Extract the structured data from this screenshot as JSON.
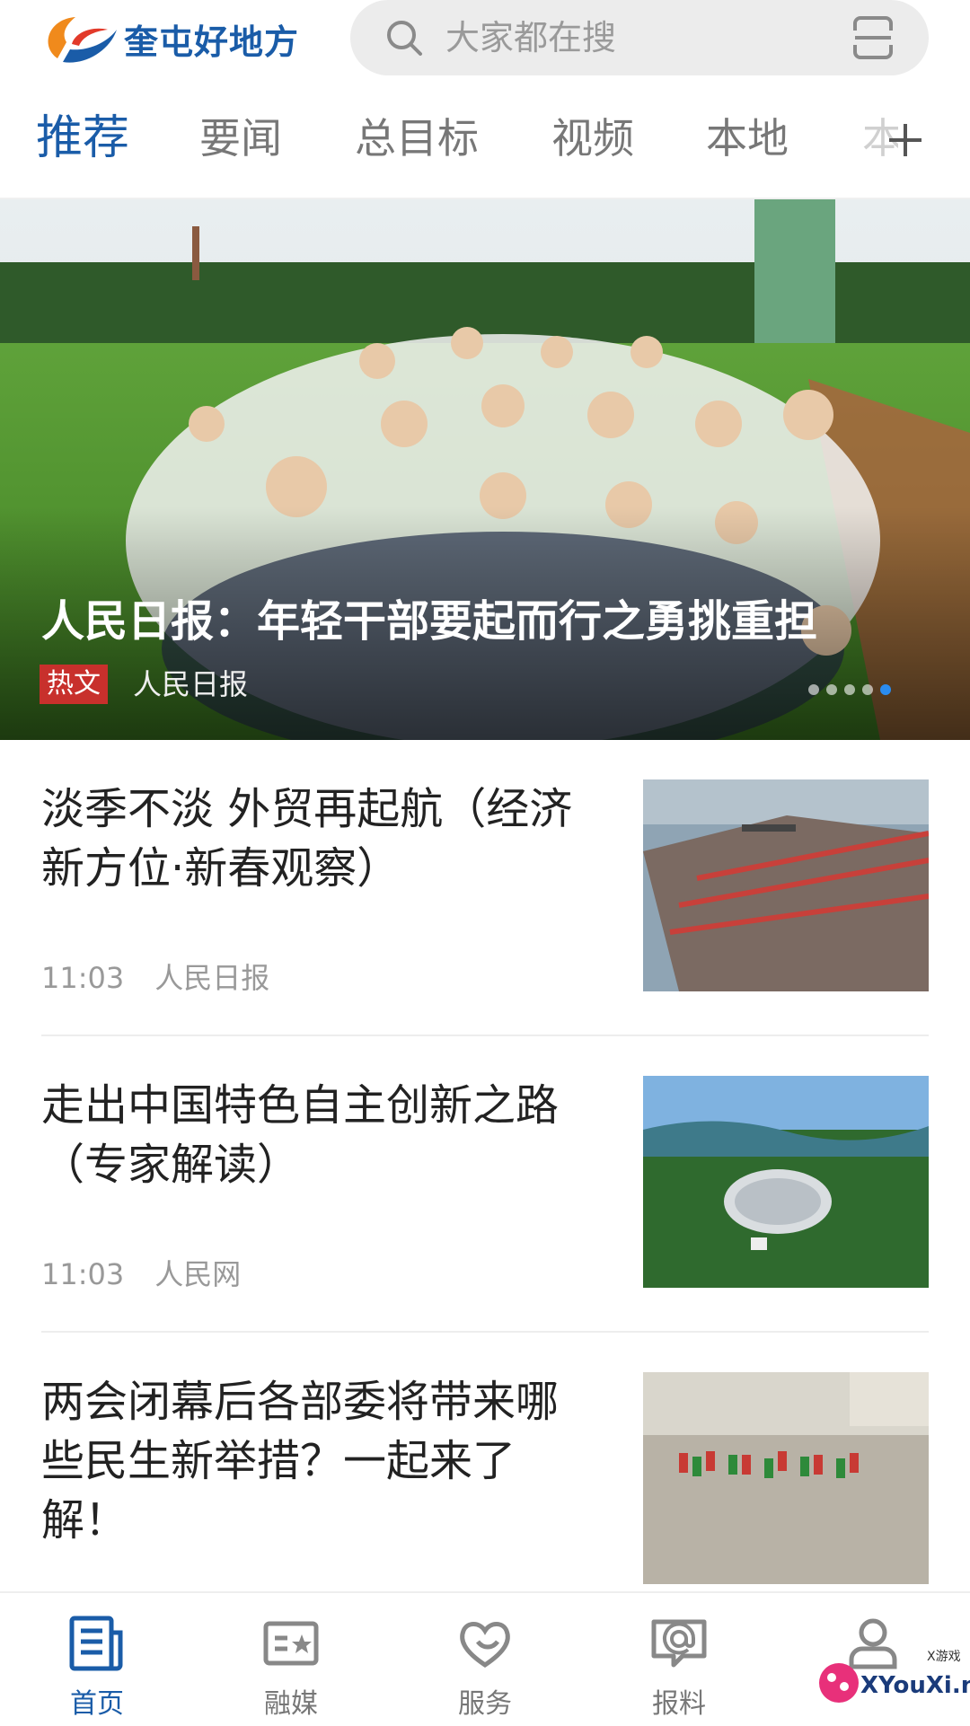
{
  "header": {
    "logo_text": "奎屯好地方",
    "search_placeholder": "大家都在搜"
  },
  "tabs": [
    {
      "label": "推荐",
      "active": true
    },
    {
      "label": "要闻",
      "active": false
    },
    {
      "label": "总目标",
      "active": false
    },
    {
      "label": "视频",
      "active": false
    },
    {
      "label": "本地",
      "active": false
    },
    {
      "label": "本",
      "active": false
    }
  ],
  "hero": {
    "title": "人民日报：年轻干部要起而行之勇挑重担",
    "badge": "热文",
    "source": "人民日报",
    "slide_count": 5,
    "active_slide": 5
  },
  "news": [
    {
      "title": "淡季不淡 外贸再起航（经济新方位·新春观察）",
      "time": "11:03",
      "source": "人民日报",
      "thumb": "port-containers"
    },
    {
      "title": "走出中国特色自主创新之路（专家解读）",
      "time": "11:03",
      "source": "人民网",
      "thumb": "radio-telescope"
    },
    {
      "title": "两会闭幕后各部委将带来哪些民生新举措？一起来了解！",
      "time": "",
      "source": "",
      "thumb": "square-dance"
    }
  ],
  "bottom_nav": [
    {
      "label": "首页",
      "icon": "news-icon",
      "active": true
    },
    {
      "label": "融媒",
      "icon": "media-card-icon",
      "active": false
    },
    {
      "label": "服务",
      "icon": "heart-service-icon",
      "active": false
    },
    {
      "label": "报料",
      "icon": "report-chat-icon",
      "active": false
    },
    {
      "label": "",
      "icon": "user-icon",
      "active": false
    }
  ],
  "watermark": {
    "text": "XYouXi.net",
    "small": "X游戏"
  },
  "colors": {
    "brand": "#1a5ca8",
    "badge": "#c8302c",
    "active_dot": "#2a8cf0"
  }
}
